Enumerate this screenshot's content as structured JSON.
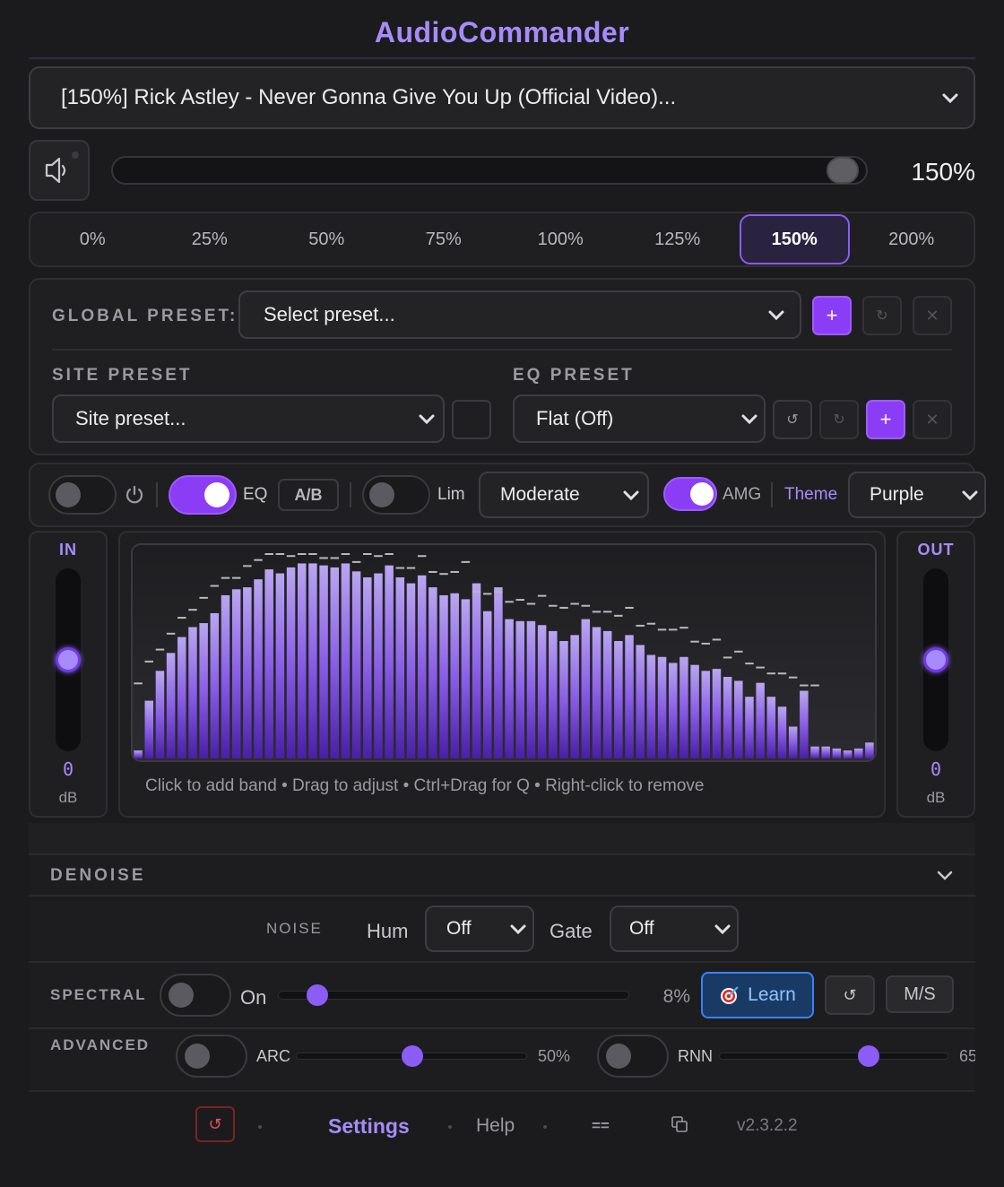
{
  "app": {
    "title": "AudioCommander"
  },
  "tab_select": {
    "value": "[150%] Rick Astley - Never Gonna Give You Up (Official Video)..."
  },
  "volume": {
    "readout": "150%",
    "level": 0.99
  },
  "volume_presets": [
    {
      "label": "0%",
      "active": false
    },
    {
      "label": "25%",
      "active": false
    },
    {
      "label": "50%",
      "active": false
    },
    {
      "label": "75%",
      "active": false
    },
    {
      "label": "100%",
      "active": false
    },
    {
      "label": "125%",
      "active": false
    },
    {
      "label": "150%",
      "active": true
    },
    {
      "label": "200%",
      "active": false
    }
  ],
  "presets": {
    "global_label": "GLOBAL PRESET:",
    "global_value": "Select preset...",
    "site_label": "SITE PRESET",
    "site_value": "Site preset...",
    "eq_label": "EQ PRESET",
    "eq_value": "Flat (Off)",
    "add_glyph": "+",
    "undo_glyph": "↺",
    "redo_glyph": "↻",
    "close_glyph": "✕"
  },
  "toolbar": {
    "eq_label": "EQ",
    "ab_label": "A/B",
    "lim_label": "Lim",
    "lim_mode": "Moderate",
    "amg_label": "AMG",
    "theme_label": "Theme",
    "theme_value": "Purple",
    "power_on": false,
    "eq_on": true,
    "lim_on": false,
    "amg_on": true
  },
  "meters": {
    "in_label": "IN",
    "in_value": "0",
    "in_unit": "dB",
    "in_level": 0.5,
    "out_label": "OUT",
    "out_value": "0",
    "out_unit": "dB",
    "out_level": 0.5
  },
  "analyzer": {
    "hint": "Click to add band • Drag to adjust • Ctrl+Drag for Q • Right-click to remove",
    "bars": [
      0.04,
      0.29,
      0.44,
      0.53,
      0.61,
      0.66,
      0.68,
      0.73,
      0.82,
      0.85,
      0.86,
      0.9,
      0.95,
      0.93,
      0.96,
      0.98,
      0.98,
      0.97,
      0.96,
      0.98,
      0.94,
      0.91,
      0.93,
      0.97,
      0.91,
      0.88,
      0.92,
      0.86,
      0.82,
      0.83,
      0.8,
      0.88,
      0.74,
      0.86,
      0.7,
      0.69,
      0.69,
      0.67,
      0.64,
      0.59,
      0.62,
      0.7,
      0.66,
      0.64,
      0.59,
      0.62,
      0.57,
      0.52,
      0.51,
      0.48,
      0.51,
      0.47,
      0.44,
      0.45,
      0.41,
      0.39,
      0.31,
      0.38,
      0.31,
      0.26,
      0.16,
      0.34,
      0.06,
      0.06,
      0.05,
      0.04,
      0.05,
      0.08
    ],
    "peaks": [
      0.35,
      0.46,
      0.52,
      0.6,
      0.68,
      0.72,
      0.78,
      0.84,
      0.88,
      0.88,
      0.94,
      0.97,
      1.0,
      1.0,
      0.99,
      1.0,
      1.0,
      0.98,
      0.98,
      1.0,
      0.96,
      1.0,
      0.99,
      1.0,
      0.93,
      0.93,
      0.99,
      0.91,
      0.9,
      0.91,
      0.96,
      0.81,
      0.8,
      0.81,
      0.76,
      0.77,
      0.75,
      0.79,
      0.74,
      0.73,
      0.75,
      0.74,
      0.71,
      0.71,
      0.69,
      0.73,
      0.64,
      0.65,
      0.62,
      0.62,
      0.63,
      0.56,
      0.55,
      0.57,
      0.48,
      0.51,
      0.45,
      0.43,
      0.4,
      0.4,
      0.38,
      0.34,
      0.34
    ]
  },
  "denoise": {
    "title": "DENOISE",
    "noise_label": "NOISE",
    "hum_label": "Hum",
    "hum_value": "Off",
    "gate_label": "Gate",
    "gate_value": "Off",
    "spectral_label": "SPECTRAL",
    "spectral_on_label": "On",
    "spectral_value": "8%",
    "spectral_level": 0.08,
    "learn_label": "Learn",
    "reset_glyph": "↺",
    "ms_label": "M/S",
    "advanced_label": "ADVANCED",
    "arc_label": "ARC",
    "arc_value": "50%",
    "arc_level": 0.5,
    "rnn_label": "RNN",
    "rnn_value": "65",
    "rnn_level": 0.65
  },
  "footer": {
    "reset_glyph": "↺",
    "settings": "Settings",
    "help": "Help",
    "menu_glyph": "==",
    "version": "v2.3.2.2"
  },
  "colors": {
    "accent": "#8b5cf6",
    "brand": "#a78bfa",
    "background": "#1b1b1d"
  }
}
